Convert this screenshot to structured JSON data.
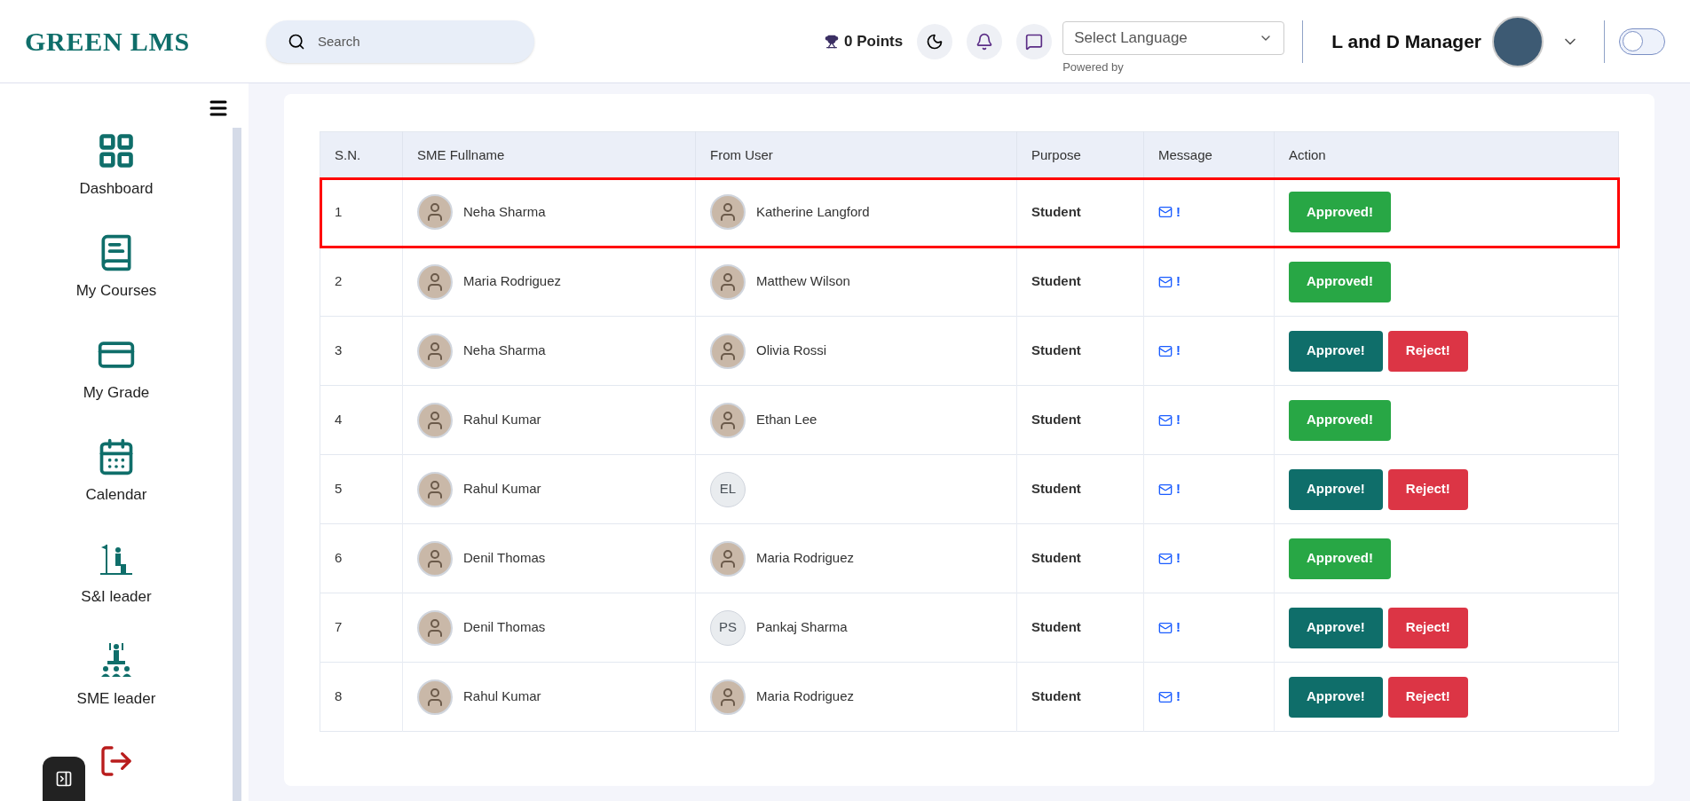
{
  "header": {
    "logo": "GREEN LMS",
    "search": {
      "placeholder": "Search"
    },
    "points": "0 Points",
    "language": {
      "value": "Select Language",
      "note": "Powered by"
    },
    "user": "L and D Manager",
    "toggle_on": false
  },
  "sidebar": {
    "items": [
      "Dashboard",
      "My Courses",
      "My Grade",
      "Calendar",
      "S&I leader",
      "SME leader"
    ]
  },
  "table": {
    "columns": [
      "S.N.",
      "SME Fullname",
      "From User",
      "Purpose",
      "Message",
      "Action"
    ],
    "rows": [
      {
        "sn": "1",
        "sme": "Neha Sharma",
        "from": {
          "name": "Katherine Langford"
        },
        "purpose": "Student",
        "message": "!",
        "actions": [
          {
            "kind": "approved",
            "label": "Approved!"
          }
        ],
        "highlighted": true
      },
      {
        "sn": "2",
        "sme": "Maria Rodriguez",
        "from": {
          "name": "Matthew Wilson"
        },
        "purpose": "Student",
        "message": "!",
        "actions": [
          {
            "kind": "approved",
            "label": "Approved!"
          }
        ],
        "highlighted": false
      },
      {
        "sn": "3",
        "sme": "Neha Sharma",
        "from": {
          "name": "Olivia Rossi"
        },
        "purpose": "Student",
        "message": "!",
        "actions": [
          {
            "kind": "approve",
            "label": "Approve!"
          },
          {
            "kind": "reject",
            "label": "Reject!"
          }
        ],
        "highlighted": false
      },
      {
        "sn": "4",
        "sme": "Rahul Kumar",
        "from": {
          "name": "Ethan Lee"
        },
        "purpose": "Student",
        "message": "!",
        "actions": [
          {
            "kind": "approved",
            "label": "Approved!"
          }
        ],
        "highlighted": false
      },
      {
        "sn": "5",
        "sme": "Rahul Kumar",
        "from": {
          "initials": "EL"
        },
        "purpose": "Student",
        "message": "!",
        "actions": [
          {
            "kind": "approve",
            "label": "Approve!"
          },
          {
            "kind": "reject",
            "label": "Reject!"
          }
        ],
        "highlighted": false
      },
      {
        "sn": "6",
        "sme": "Denil Thomas",
        "from": {
          "name": "Maria Rodriguez"
        },
        "purpose": "Student",
        "message": "!",
        "actions": [
          {
            "kind": "approved",
            "label": "Approved!"
          }
        ],
        "highlighted": false
      },
      {
        "sn": "7",
        "sme": "Denil Thomas",
        "from": {
          "initials": "PS",
          "name": "Pankaj Sharma"
        },
        "purpose": "Student",
        "message": "!",
        "actions": [
          {
            "kind": "approve",
            "label": "Approve!"
          },
          {
            "kind": "reject",
            "label": "Reject!"
          }
        ],
        "highlighted": false
      },
      {
        "sn": "8",
        "sme": "Rahul Kumar",
        "from": {
          "name": "Maria Rodriguez"
        },
        "purpose": "Student",
        "message": "!",
        "actions": [
          {
            "kind": "approve",
            "label": "Approve!"
          },
          {
            "kind": "reject",
            "label": "Reject!"
          }
        ],
        "highlighted": false
      }
    ]
  }
}
